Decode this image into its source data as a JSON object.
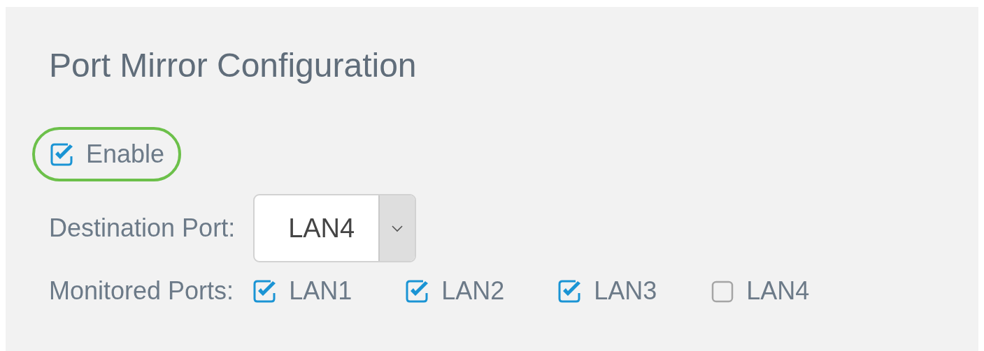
{
  "title": "Port Mirror Configuration",
  "enable": {
    "label": "Enable",
    "checked": true,
    "highlighted": true
  },
  "destination_port": {
    "label": "Destination Port:",
    "value": "LAN4"
  },
  "monitored_ports": {
    "label": "Monitored Ports:",
    "ports": [
      {
        "label": "LAN1",
        "checked": true
      },
      {
        "label": "LAN2",
        "checked": true
      },
      {
        "label": "LAN3",
        "checked": true
      },
      {
        "label": "LAN4",
        "checked": false
      }
    ]
  }
}
